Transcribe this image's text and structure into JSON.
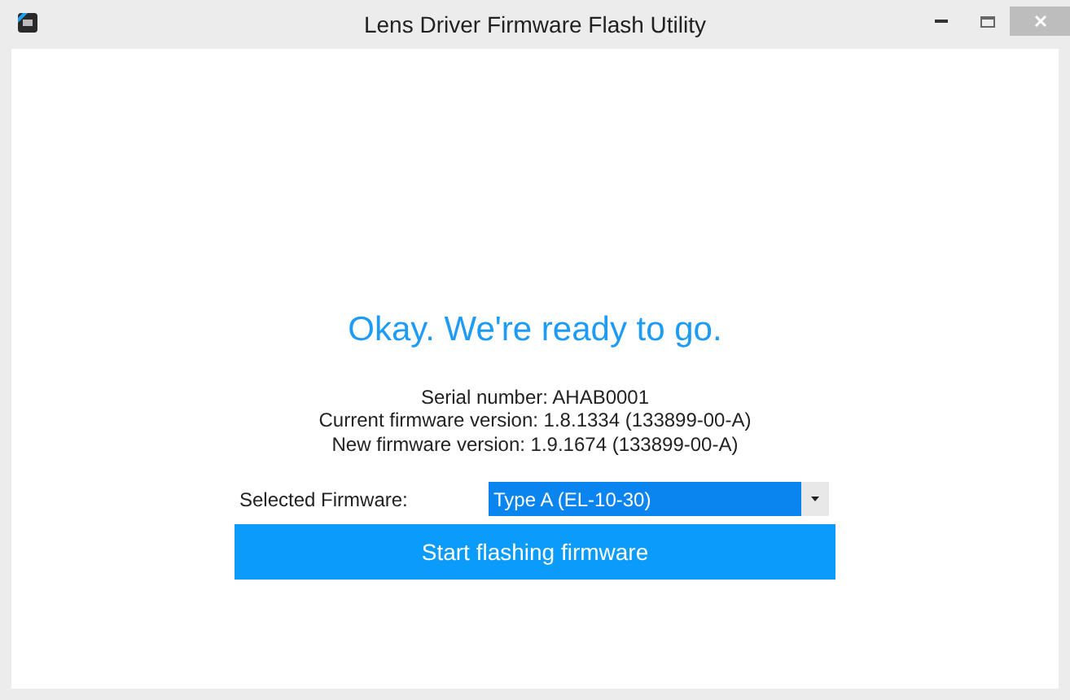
{
  "window": {
    "title": "Lens Driver Firmware Flash Utility"
  },
  "heading": "Okay. We're ready to go.",
  "info_lines": [
    "Serial number: AHAB0001",
    "Current firmware version: 1.8.1334 (133899-00-A)",
    "New firmware version: 1.9.1674 (133899-00-A)"
  ],
  "firmware_select": {
    "label": "Selected Firmware:",
    "value": "Type A (EL-10-30)"
  },
  "start_button": "Start flashing firmware"
}
